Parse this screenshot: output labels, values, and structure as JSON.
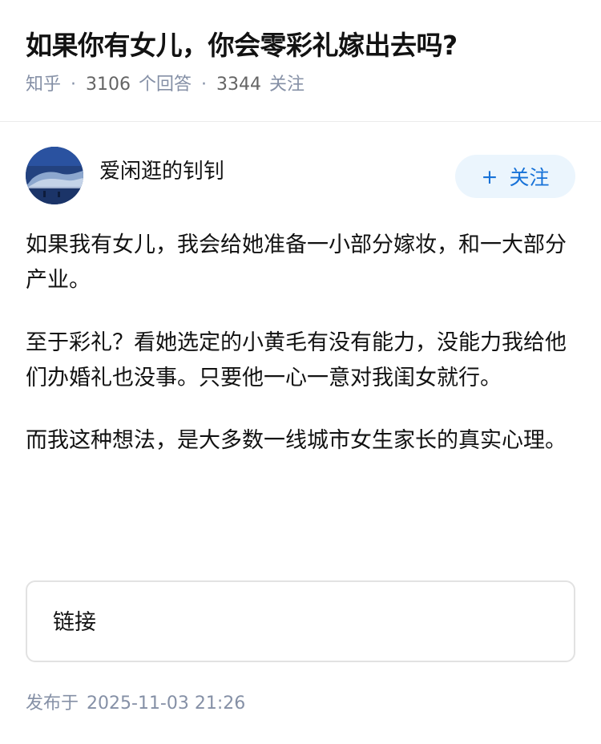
{
  "question": {
    "title": "如果你有女儿，你会零彩礼嫁出去吗?",
    "source": "知乎",
    "separator": "·",
    "answer_count": "3106",
    "answer_label": "个回答",
    "follower_count": "3344",
    "follower_label": "关注"
  },
  "author": {
    "name": "爱闲逛的钊钊",
    "avatar_icon": "avatar-photo",
    "follow_plus": "+",
    "follow_label": "关注"
  },
  "answer": {
    "paragraphs": [
      "如果我有女儿，我会给她准备一小部分嫁妆，和一大部分产业。",
      "至于彩礼？看她选定的小黄毛有没有能力，没能力我给他们办婚礼也没事。只要他一心一意对我闺女就行。",
      "而我这种想法，是大多数一线城市女生家长的真实心理。"
    ],
    "link_card_label": "链接"
  },
  "footer": {
    "publish_label": "发布于",
    "publish_time": "2025-11-03 21:26"
  },
  "colors": {
    "accent": "#1772d8",
    "follow_bg": "#ebf5fd",
    "meta_gray": "#8590a6"
  }
}
